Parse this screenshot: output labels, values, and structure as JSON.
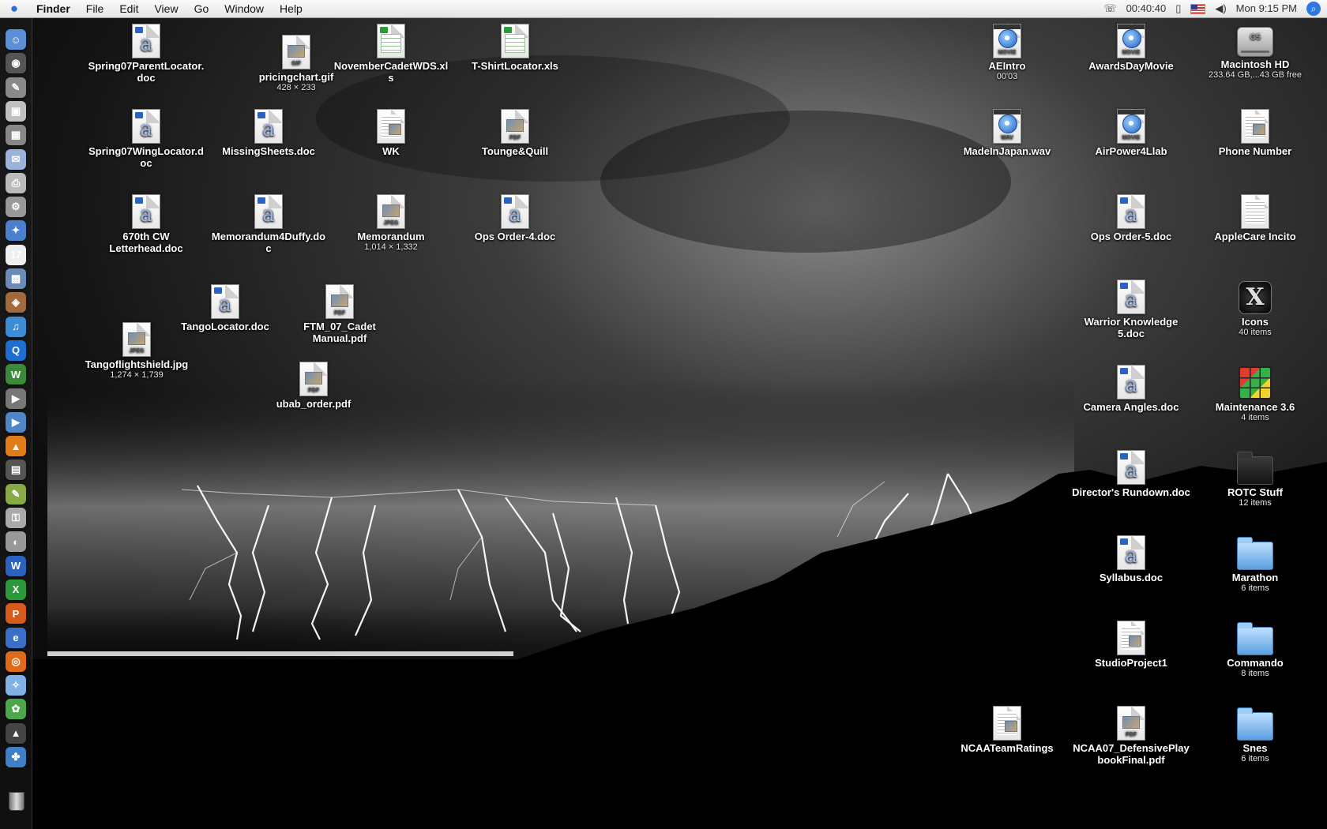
{
  "menubar": {
    "app": "Finder",
    "menus": [
      "File",
      "Edit",
      "View",
      "Go",
      "Window",
      "Help"
    ],
    "timer": "00:40:40",
    "clock": "Mon 9:15 PM",
    "icons": [
      "apple-icon",
      "phone-icon",
      "sync-icon",
      "flag-icon",
      "volume-icon",
      "spotlight-icon"
    ]
  },
  "dock": {
    "items": [
      {
        "name": "finder",
        "color": "#5a8fd8",
        "glyph": "☺"
      },
      {
        "name": "dashboard",
        "color": "#555555",
        "glyph": "◉"
      },
      {
        "name": "automator",
        "color": "#8a8a8a",
        "glyph": "✎"
      },
      {
        "name": "preview",
        "color": "#c0c0c0",
        "glyph": "▣"
      },
      {
        "name": "calculator",
        "color": "#888888",
        "glyph": "▦"
      },
      {
        "name": "mail",
        "color": "#9ab3d8",
        "glyph": "✉"
      },
      {
        "name": "printer",
        "color": "#bbbbbb",
        "glyph": "⎙"
      },
      {
        "name": "system-preferences",
        "color": "#999999",
        "glyph": "⚙"
      },
      {
        "name": "safari-bookmarks",
        "color": "#4b7fd0",
        "glyph": "✦"
      },
      {
        "name": "ical",
        "color": "#eeeeee",
        "glyph": "17"
      },
      {
        "name": "iphoto",
        "color": "#6c8bb8",
        "glyph": "▩"
      },
      {
        "name": "photo-booth",
        "color": "#a06a3c",
        "glyph": "◈"
      },
      {
        "name": "itunes",
        "color": "#3d8cd6",
        "glyph": "♫"
      },
      {
        "name": "quicktime",
        "color": "#1c6fd0",
        "glyph": "Q"
      },
      {
        "name": "flip4mac",
        "color": "#3a8a3a",
        "glyph": "W"
      },
      {
        "name": "dvd-player",
        "color": "#777777",
        "glyph": "▶"
      },
      {
        "name": "media-player",
        "color": "#4e86c8",
        "glyph": "▶"
      },
      {
        "name": "vlc",
        "color": "#e07d1a",
        "glyph": "▲"
      },
      {
        "name": "clapboard",
        "color": "#555555",
        "glyph": "▤"
      },
      {
        "name": "text-edit",
        "color": "#88aa44",
        "glyph": "✎"
      },
      {
        "name": "keychain",
        "color": "#aaaaaa",
        "glyph": "⚿"
      },
      {
        "name": "disk-utility",
        "color": "#999999",
        "glyph": "◐"
      },
      {
        "name": "word",
        "color": "#2a62c2",
        "glyph": "W"
      },
      {
        "name": "excel",
        "color": "#2a9a3a",
        "glyph": "X"
      },
      {
        "name": "powerpoint",
        "color": "#d65a1a",
        "glyph": "P"
      },
      {
        "name": "internet-explorer",
        "color": "#3a6fc8",
        "glyph": "e"
      },
      {
        "name": "firefox",
        "color": "#e06a1a",
        "glyph": "◎"
      },
      {
        "name": "safari",
        "color": "#7fb0e6",
        "glyph": "✧"
      },
      {
        "name": "burn",
        "color": "#4aa84a",
        "glyph": "✿"
      },
      {
        "name": "witch",
        "color": "#444444",
        "glyph": "▲"
      },
      {
        "name": "network",
        "color": "#3f7fc8",
        "glyph": "✤"
      }
    ],
    "trash": "trash-icon"
  },
  "desktop": {
    "left": [
      {
        "label": "Spring07ParentLocator.doc",
        "kind": "word"
      },
      {
        "label": "pricingchart.gif",
        "sub": "428 × 233",
        "kind": "gif"
      },
      {
        "label": "NovemberCadetWDS.xls",
        "kind": "excel"
      },
      {
        "label": "T-ShirtLocator.xls",
        "kind": "excel"
      },
      {
        "label": "Spring07WingLocator.doc",
        "kind": "word"
      },
      {
        "label": "MissingSheets.doc",
        "kind": "word"
      },
      {
        "label": "WK",
        "kind": "textclip"
      },
      {
        "label": "Tounge&Quill",
        "kind": "pdf"
      },
      {
        "label": "670th CW Letterhead.doc",
        "kind": "word"
      },
      {
        "label": "Memorandum4Duffy.doc",
        "kind": "word"
      },
      {
        "label": "Memorandum",
        "sub": "1,014 × 1,332",
        "kind": "jpeg"
      },
      {
        "label": "Ops Order-4.doc",
        "kind": "word"
      },
      {
        "label": "TangoLocator.doc",
        "kind": "word"
      },
      {
        "label": "FTM_07_Cadet Manual.pdf",
        "kind": "pdf"
      },
      {
        "label": "Tangoflightshield.jpg",
        "sub": "1,274 × 1,739",
        "kind": "jpeg"
      },
      {
        "label": "ubab_order.pdf",
        "kind": "pdf"
      }
    ],
    "right": [
      {
        "label": "AEIntro",
        "sub": "00'03",
        "kind": "movie"
      },
      {
        "label": "AwardsDayMovie",
        "kind": "movie"
      },
      {
        "label": "Macintosh HD",
        "sub": "233.64 GB,...43 GB free",
        "kind": "drive"
      },
      {
        "label": "MadeInJapan.wav",
        "kind": "wav"
      },
      {
        "label": "AirPower4Llab",
        "kind": "movie"
      },
      {
        "label": "Phone Number",
        "kind": "textclip"
      },
      {
        "label": "Ops Order-5.doc",
        "kind": "word"
      },
      {
        "label": "AppleCare Incito",
        "kind": "text"
      },
      {
        "label": "Warrior Knowledge 5.doc",
        "kind": "word"
      },
      {
        "label": "Icons",
        "sub": "40 items",
        "kind": "xfolder"
      },
      {
        "label": "Camera Angles.doc",
        "kind": "word"
      },
      {
        "label": "Maintenance 3.6",
        "sub": "4 items",
        "kind": "rubik"
      },
      {
        "label": "Director's Rundown.doc",
        "kind": "word"
      },
      {
        "label": "ROTC Stuff",
        "sub": "12 items",
        "kind": "darkfolder"
      },
      {
        "label": "Syllabus.doc",
        "kind": "word"
      },
      {
        "label": "Marathon",
        "sub": "6 items",
        "kind": "folder"
      },
      {
        "label": "StudioProject1",
        "kind": "textclip"
      },
      {
        "label": "Commando",
        "sub": "8 items",
        "kind": "folder"
      },
      {
        "label": "NCAATeamRatings",
        "kind": "textclip"
      },
      {
        "label": "NCAA07_DefensivePlaybookFinal.pdf",
        "kind": "pdf"
      },
      {
        "label": "Snes",
        "sub": "6 items",
        "kind": "folder"
      }
    ]
  },
  "icon_tags": {
    "gif": "GIF",
    "jpeg": "JPEG",
    "pdf": "PDF",
    "movie": "MOVIE",
    "wav": "WAV",
    "drive": "G5"
  },
  "colors": {
    "accent": "#2c78e0",
    "word": "#2a62c2",
    "excel": "#2a9a3a"
  }
}
